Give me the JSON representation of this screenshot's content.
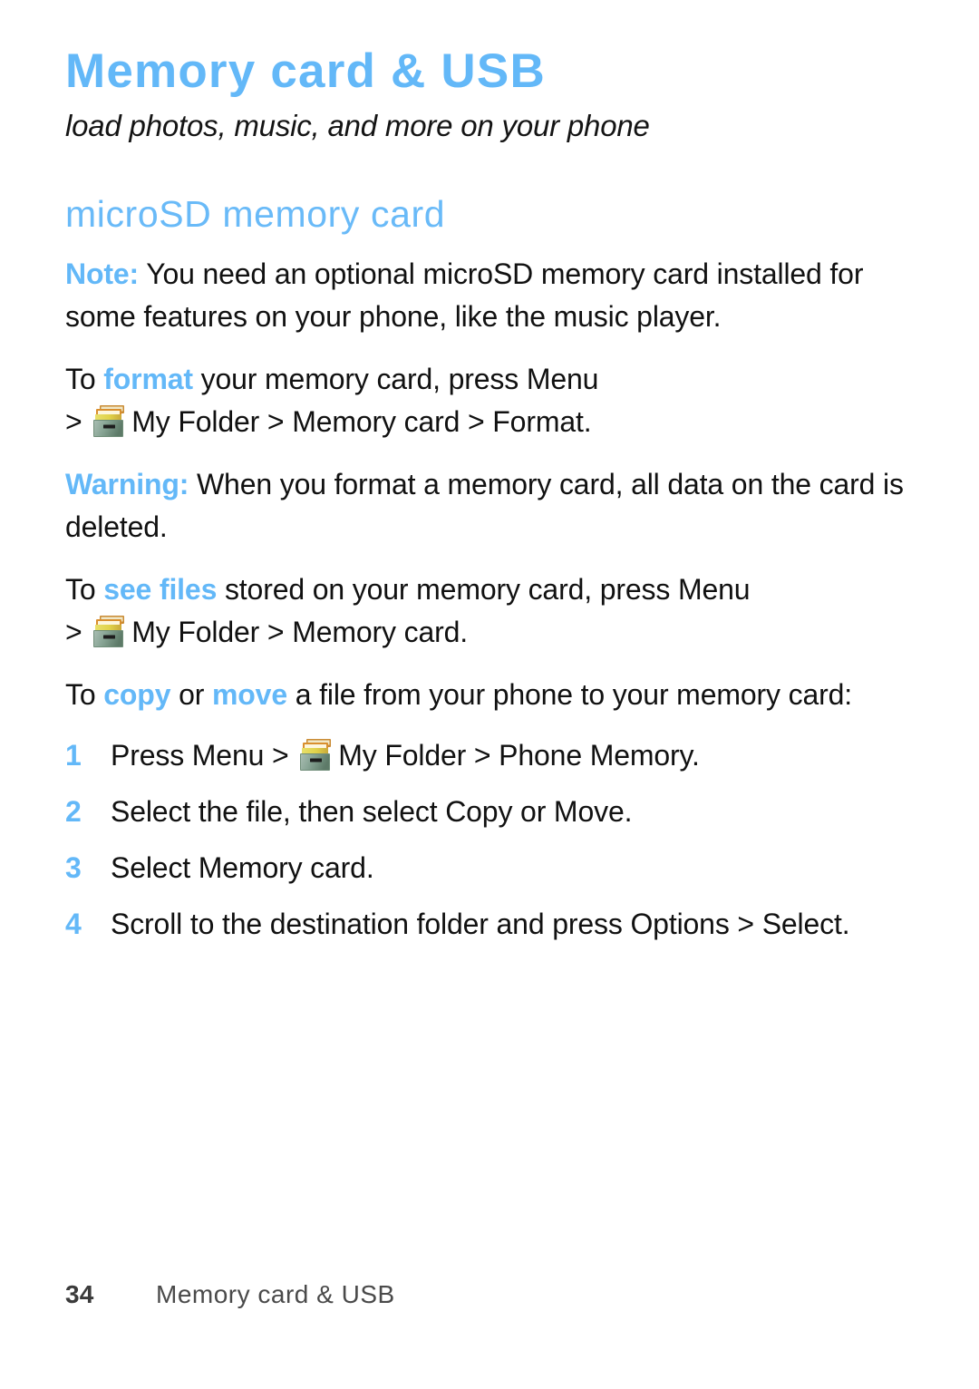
{
  "chapter": {
    "title": "Memory card & USB",
    "subtitle": "load photos, music, and more on your phone"
  },
  "section": {
    "heading": "microSD memory card"
  },
  "paragraphs": {
    "note": {
      "label": "Note:",
      "text": " You need an optional microSD memory card installed for some features on your phone, like the music player."
    },
    "format": {
      "pre": "To ",
      "accent": "format",
      "post": " your memory card, press Menu",
      "path_pre": "> ",
      "path_post": "My Folder > Memory card > Format."
    },
    "warning": {
      "label": "Warning:",
      "text": " When you format a memory card, all data on the card is deleted."
    },
    "see_files": {
      "pre": "To ",
      "accent": "see files",
      "post": " stored on your memory card, press Menu",
      "path_pre": "> ",
      "path_post": "My Folder > Memory card."
    },
    "copy_move": {
      "pre": "To ",
      "accent1": "copy",
      "mid": " or ",
      "accent2": "move",
      "post": " a file from your phone to your memory card:"
    }
  },
  "steps": [
    {
      "num": "1",
      "pre": "Press Menu > ",
      "has_icon": true,
      "post": "My Folder > Phone Memory."
    },
    {
      "num": "2",
      "pre": "Select the file, then select Copy or Move.",
      "has_icon": false,
      "post": ""
    },
    {
      "num": "3",
      "pre": "Select Memory card.",
      "has_icon": false,
      "post": ""
    },
    {
      "num": "4",
      "pre": "Scroll to the destination folder and press Options > Select.",
      "has_icon": false,
      "post": ""
    }
  ],
  "footer": {
    "page_number": "34",
    "title": "Memory card & USB"
  },
  "icons": {
    "my_folder": "file-cabinet-folder-icon"
  },
  "colors": {
    "accent_blue": "#63b8f8",
    "heading_blue": "#69baf8",
    "body_text": "#111111",
    "footer_text": "#4a4a4a",
    "background": "#ffffff"
  }
}
